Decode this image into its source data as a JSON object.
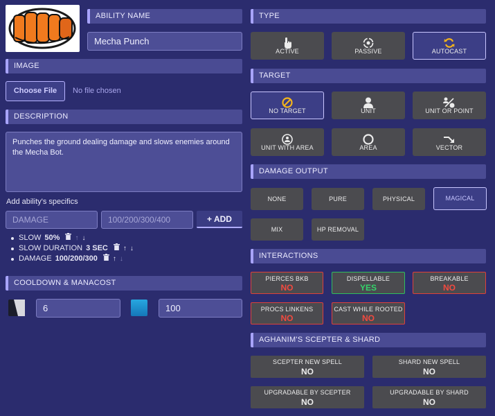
{
  "ability": {
    "name_header": "ABILITY NAME",
    "name_value": "Mecha Punch"
  },
  "image": {
    "header": "IMAGE",
    "choose_label": "Choose File",
    "no_file": "No file chosen"
  },
  "description": {
    "header": "DESCRIPTION",
    "text": "Punches the ground dealing damage and slows enemies around the Mecha Bot."
  },
  "specifics": {
    "title": "Add ability's specifics",
    "name_placeholder": "DAMAGE",
    "value_placeholder": "100/200/300/400",
    "add_label": "+  ADD",
    "items": [
      {
        "name": "SLOW",
        "value": "50%"
      },
      {
        "name": "SLOW DURATION",
        "value": "3 SEC"
      },
      {
        "name": "DAMAGE",
        "value": "100/200/300"
      }
    ]
  },
  "cooldown": {
    "header": "COOLDOWN & MANACOST",
    "cooldown_value": "6",
    "manacost_value": "100"
  },
  "type": {
    "header": "TYPE",
    "options": [
      "ACTIVE",
      "PASSIVE",
      "AUTOCAST"
    ],
    "selected": "AUTOCAST"
  },
  "target": {
    "header": "TARGET",
    "options": [
      "NO TARGET",
      "UNIT",
      "UNIT OR POINT",
      "UNIT WITH AREA",
      "AREA",
      "VECTOR"
    ],
    "selected": "NO TARGET"
  },
  "damage": {
    "header": "DAMAGE OUTPUT",
    "options": [
      "NONE",
      "PURE",
      "PHYSICAL",
      "MAGICAL",
      "MIX",
      "HP REMOVAL"
    ],
    "selected": "MAGICAL"
  },
  "interactions": {
    "header": "INTERACTIONS",
    "items": [
      {
        "label": "PIERCES BKB",
        "value": "NO"
      },
      {
        "label": "DISPELLABLE",
        "value": "YES"
      },
      {
        "label": "BREAKABLE",
        "value": "NO"
      },
      {
        "label": "PROCS LINKENS",
        "value": "NO"
      },
      {
        "label": "CAST WHILE ROOTED",
        "value": "NO"
      }
    ]
  },
  "aghanim": {
    "header": "AGHANIM'S SCEPTER & SHARD",
    "items": [
      {
        "label": "SCEPTER NEW SPELL",
        "value": "NO"
      },
      {
        "label": "SHARD NEW SPELL",
        "value": "NO"
      },
      {
        "label": "UPGRADABLE BY SCEPTER",
        "value": "NO"
      },
      {
        "label": "UPGRADABLE BY SHARD",
        "value": "NO"
      }
    ]
  },
  "colors": {
    "background": "#2b2c6e",
    "header_bg": "#4a4b93",
    "accent": "#a8a4ff",
    "no": "#f24a3f",
    "yes": "#35d36a"
  }
}
